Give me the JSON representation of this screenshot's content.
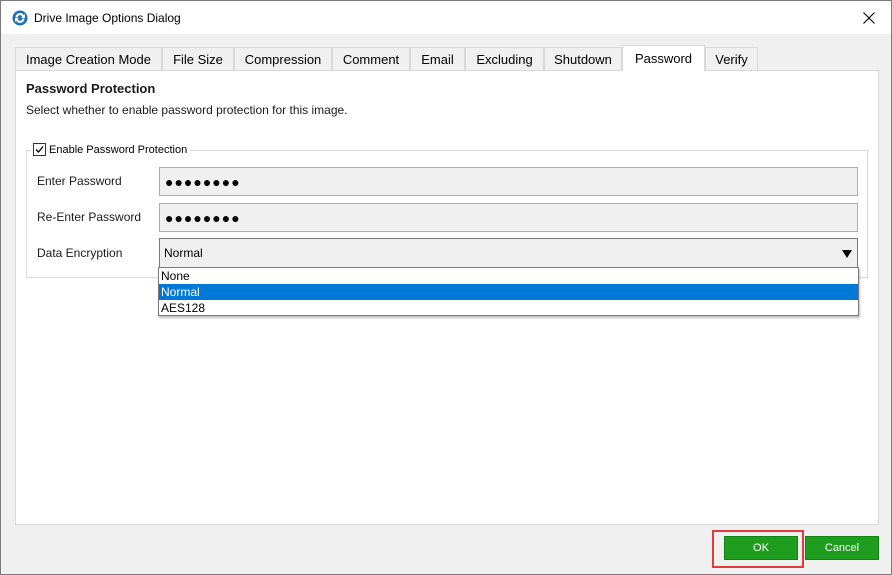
{
  "window": {
    "title": "Drive Image Options Dialog"
  },
  "tabs": [
    {
      "label": "Image Creation Mode",
      "active": false
    },
    {
      "label": "File Size",
      "active": false
    },
    {
      "label": "Compression",
      "active": false
    },
    {
      "label": "Comment",
      "active": false
    },
    {
      "label": "Email",
      "active": false
    },
    {
      "label": "Excluding",
      "active": false
    },
    {
      "label": "Shutdown",
      "active": false
    },
    {
      "label": "Password",
      "active": true
    },
    {
      "label": "Verify",
      "active": false
    }
  ],
  "panel": {
    "title": "Password Protection",
    "description": "Select whether to enable password protection for this image.",
    "enable_checkbox": {
      "label": "Enable Password Protection",
      "checked": true
    },
    "enter_password": {
      "label": "Enter Password",
      "value": "●●●●●●●●"
    },
    "reenter_password": {
      "label": "Re-Enter Password",
      "value": "●●●●●●●●"
    },
    "data_encryption": {
      "label": "Data Encryption",
      "selected": "Normal",
      "options": [
        "None",
        "Normal",
        "AES128"
      ]
    }
  },
  "buttons": {
    "ok": "OK",
    "cancel": "Cancel"
  },
  "colors": {
    "button_green": "#1e9d1e",
    "selection_blue": "#0078d7",
    "highlight_red": "#e03c3c"
  }
}
